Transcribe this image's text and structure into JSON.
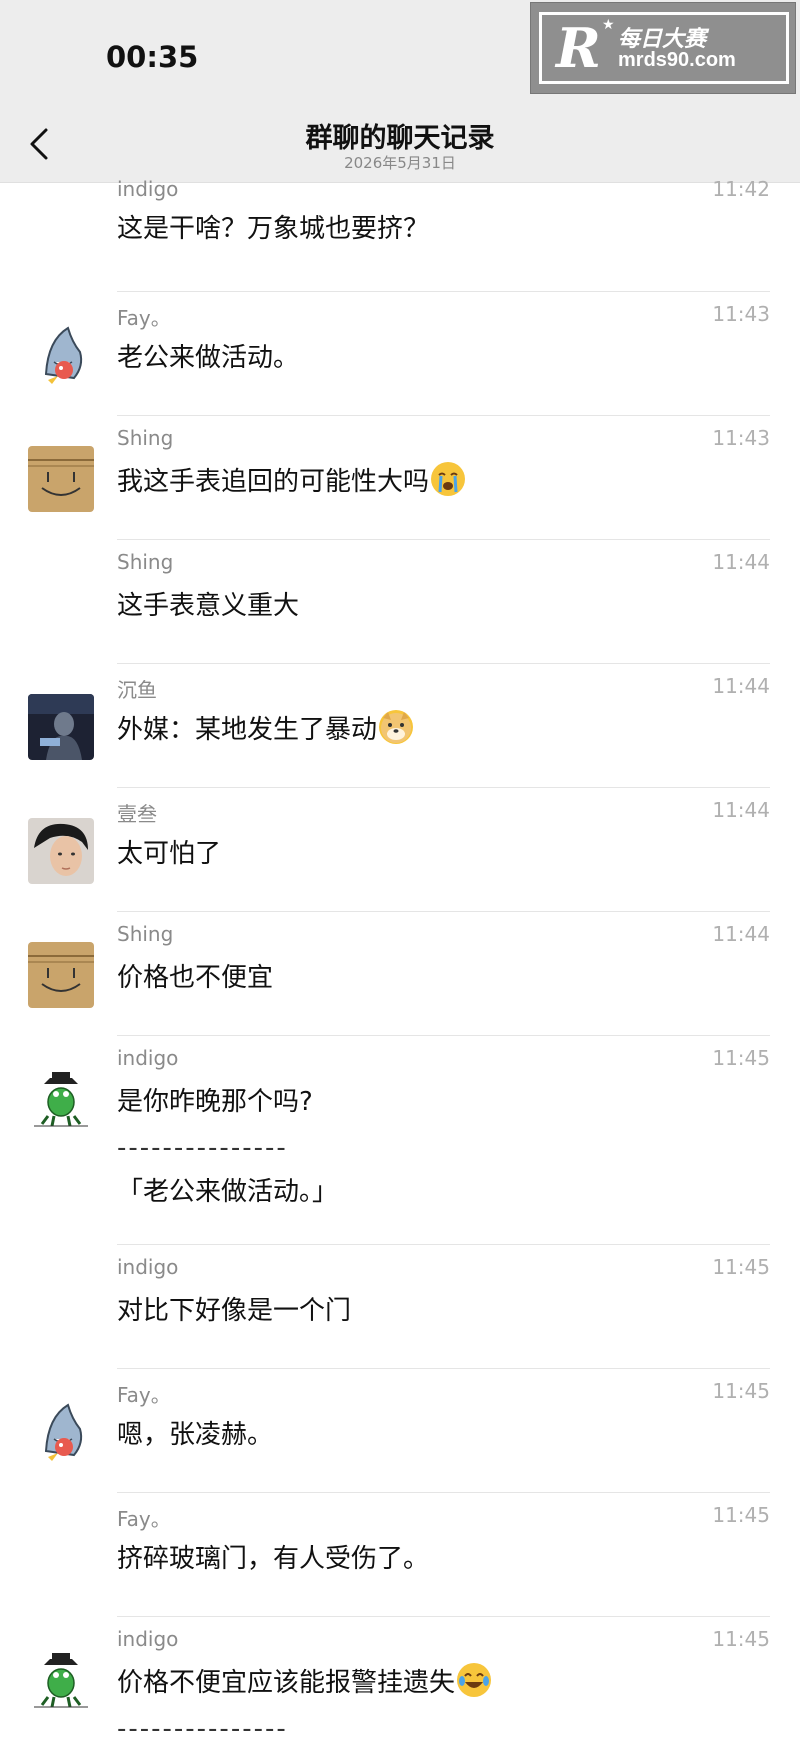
{
  "status": {
    "time": "00:35"
  },
  "watermark": {
    "logo": "R",
    "cn": "每日大赛",
    "en": "mrds90.com"
  },
  "nav": {
    "title": "群聊的聊天记录",
    "subtitle": "2026年5月31日"
  },
  "messages": [
    {
      "sender": "indigo",
      "time": "11:42",
      "text": "这是干啥？万象城也要挤？",
      "avatar": "none"
    },
    {
      "sender": "Fay。",
      "time": "11:43",
      "text": "老公来做活动。",
      "avatar": "shark-icon"
    },
    {
      "sender": "Shing",
      "time": "11:43",
      "text": "我这手表追回的可能性大吗",
      "emoji": "crying-face-icon",
      "avatar": "box-face-icon"
    },
    {
      "sender": "Shing",
      "time": "11:44",
      "text": "这手表意义重大",
      "avatar": "none"
    },
    {
      "sender": "沉鱼",
      "time": "11:44",
      "text": "外媒：某地发生了暴动",
      "emoji": "doge-icon",
      "avatar": "dark-photo-icon"
    },
    {
      "sender": "壹叁",
      "time": "11:44",
      "text": "太可怕了",
      "avatar": "portrait-photo-icon"
    },
    {
      "sender": "Shing",
      "time": "11:44",
      "text": "价格也不便宜",
      "avatar": "box-face-icon"
    },
    {
      "sender": "indigo",
      "time": "11:45",
      "text": "是你昨晚那个吗?",
      "dashes": "---------------",
      "quote": "「老公来做活动。」",
      "avatar": "cowboy-frog-icon"
    },
    {
      "sender": "indigo",
      "time": "11:45",
      "text": "对比下好像是一个门",
      "avatar": "none"
    },
    {
      "sender": "Fay。",
      "time": "11:45",
      "text": "嗯，张凌赫。",
      "avatar": "shark-icon"
    },
    {
      "sender": "Fay。",
      "time": "11:45",
      "text": "挤碎玻璃门，有人受伤了。",
      "avatar": "none"
    },
    {
      "sender": "indigo",
      "time": "11:45",
      "text": "价格不便宜应该能报警挂遗失",
      "emoji": "tears-of-joy-icon",
      "dashes": "---------------",
      "avatar": "cowboy-frog-icon"
    }
  ]
}
